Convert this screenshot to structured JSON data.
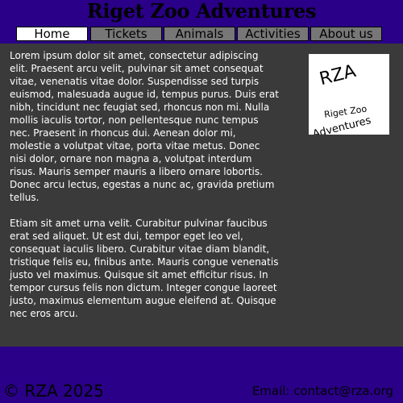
{
  "header": {
    "title": "Riget Zoo Adventures"
  },
  "nav": {
    "items": [
      {
        "label": "Home"
      },
      {
        "label": "Tickets"
      },
      {
        "label": "Animals"
      },
      {
        "label": "Activities"
      },
      {
        "label": "About us"
      }
    ],
    "active": "Home"
  },
  "main": {
    "paragraphs": [
      " Lorem ipsum dolor sit amet, consectetur adipiscing elit. Praesent arcu velit, pulvinar sit amet consequat vitae, venenatis vitae dolor. Suspendisse sed turpis euismod, malesuada augue id, tempus purus. Duis erat nibh, tincidunt nec feugiat sed, rhoncus non mi. Nulla mollis iaculis tortor, non pellentesque nunc tempus nec. Praesent in rhoncus dui. Aenean dolor mi, molestie a volutpat vitae, porta vitae metus. Donec nisi dolor, ornare non magna a, volutpat interdum risus. Mauris semper mauris a libero ornare lobortis. Donec arcu lectus, egestas a nunc ac, gravida pretium tellus.",
      "Etiam sit amet urna velit. Curabitur pulvinar faucibus erat sed aliquet. Ut est dui, tempor eget leo vel, consequat iaculis libero. Curabitur vitae diam blandit, tristique felis eu, finibus ante. Mauris congue venenatis justo vel maximus. Quisque sit amet efficitur risus. In tempor cursus felis non dictum. Integer congue laoreet justo, maximus elementum augue eleifend at. Quisque nec eros arcu."
    ]
  },
  "logo": {
    "abbr": "RZA",
    "line1": "Riget Zoo",
    "line2": "Adventures"
  },
  "footer": {
    "copyright": "© RZA 2025",
    "contact": "Email: contact@rza.org"
  },
  "colors": {
    "brand": "#2a0088",
    "content_bg": "#3a3a3a",
    "nav_bg": "#777777",
    "nav_active": "#ffffff"
  }
}
